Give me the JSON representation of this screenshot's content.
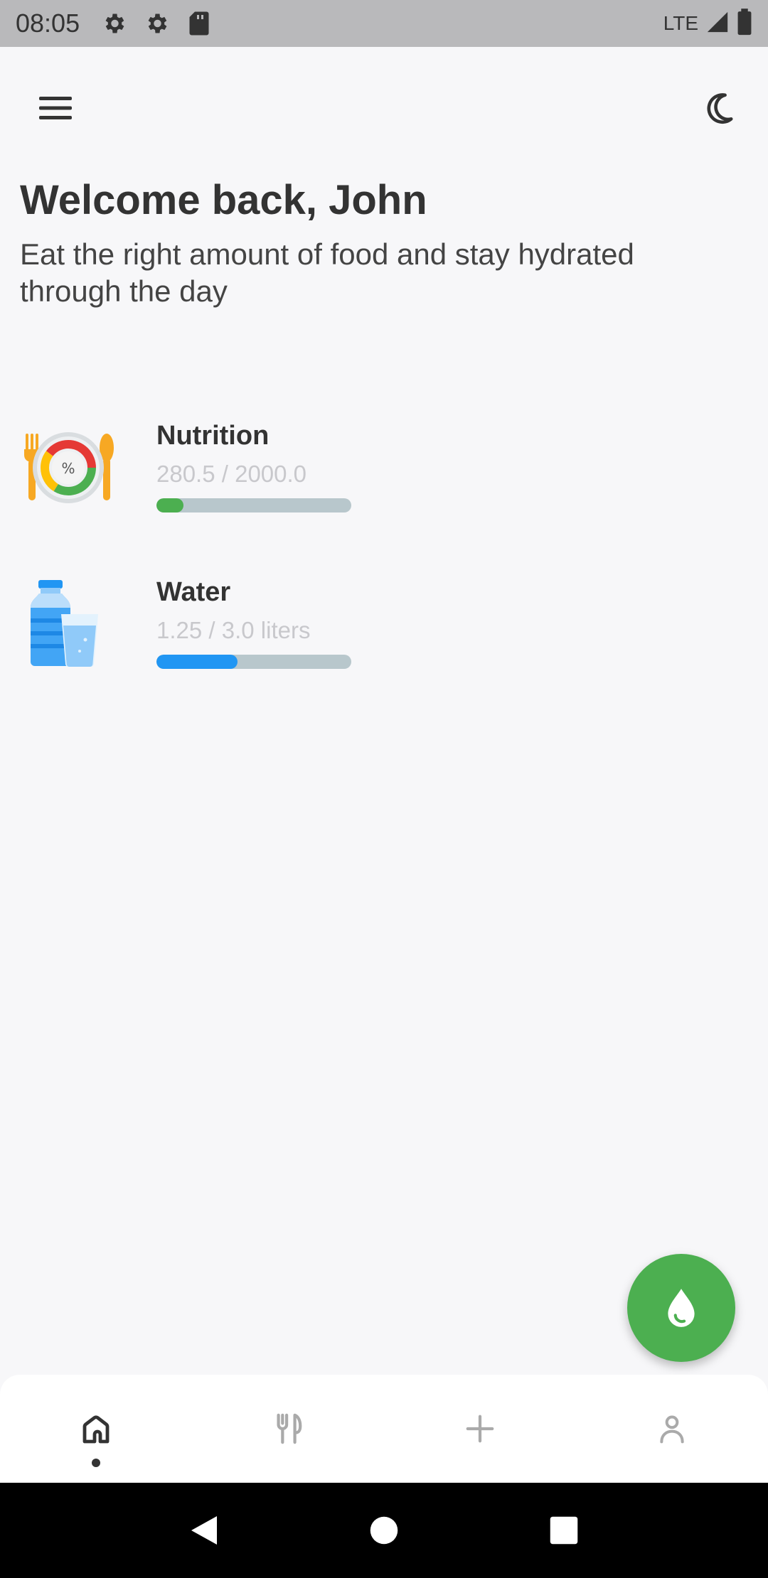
{
  "status_bar": {
    "time": "08:05",
    "network": "LTE",
    "icons": [
      "settings-gear-icon",
      "settings-gear-icon",
      "sd-card-icon",
      "signal-icon",
      "battery-icon"
    ]
  },
  "app_bar": {
    "menu_icon": "hamburger-menu-icon",
    "theme_icon": "moon-icon"
  },
  "greeting": {
    "title": "Welcome back, John",
    "subtitle": "Eat the right amount of food and stay hydrated through the day"
  },
  "trackers": [
    {
      "label": "Nutrition",
      "value_text": "280.5 / 2000.0",
      "progress": 0.14,
      "color": "#4caf50",
      "icon": "nutrition-plate-icon"
    },
    {
      "label": "Water",
      "value_text": "1.25 / 3.0 liters",
      "progress": 0.4167,
      "color": "#2196f3",
      "icon": "water-bottle-icon"
    }
  ],
  "fab": {
    "icon": "water-drop-icon",
    "color": "#4caf50"
  },
  "bottom_nav": {
    "items": [
      {
        "icon": "home-icon",
        "active": true
      },
      {
        "icon": "fork-knife-icon",
        "active": false
      },
      {
        "icon": "plus-icon",
        "active": false
      },
      {
        "icon": "person-icon",
        "active": false
      }
    ]
  },
  "colors": {
    "background": "#f7f7f9",
    "status_bar": "#b9b9bb",
    "text_primary": "#333333",
    "text_muted": "#c8c8cc",
    "track": "#b8c7cc"
  }
}
